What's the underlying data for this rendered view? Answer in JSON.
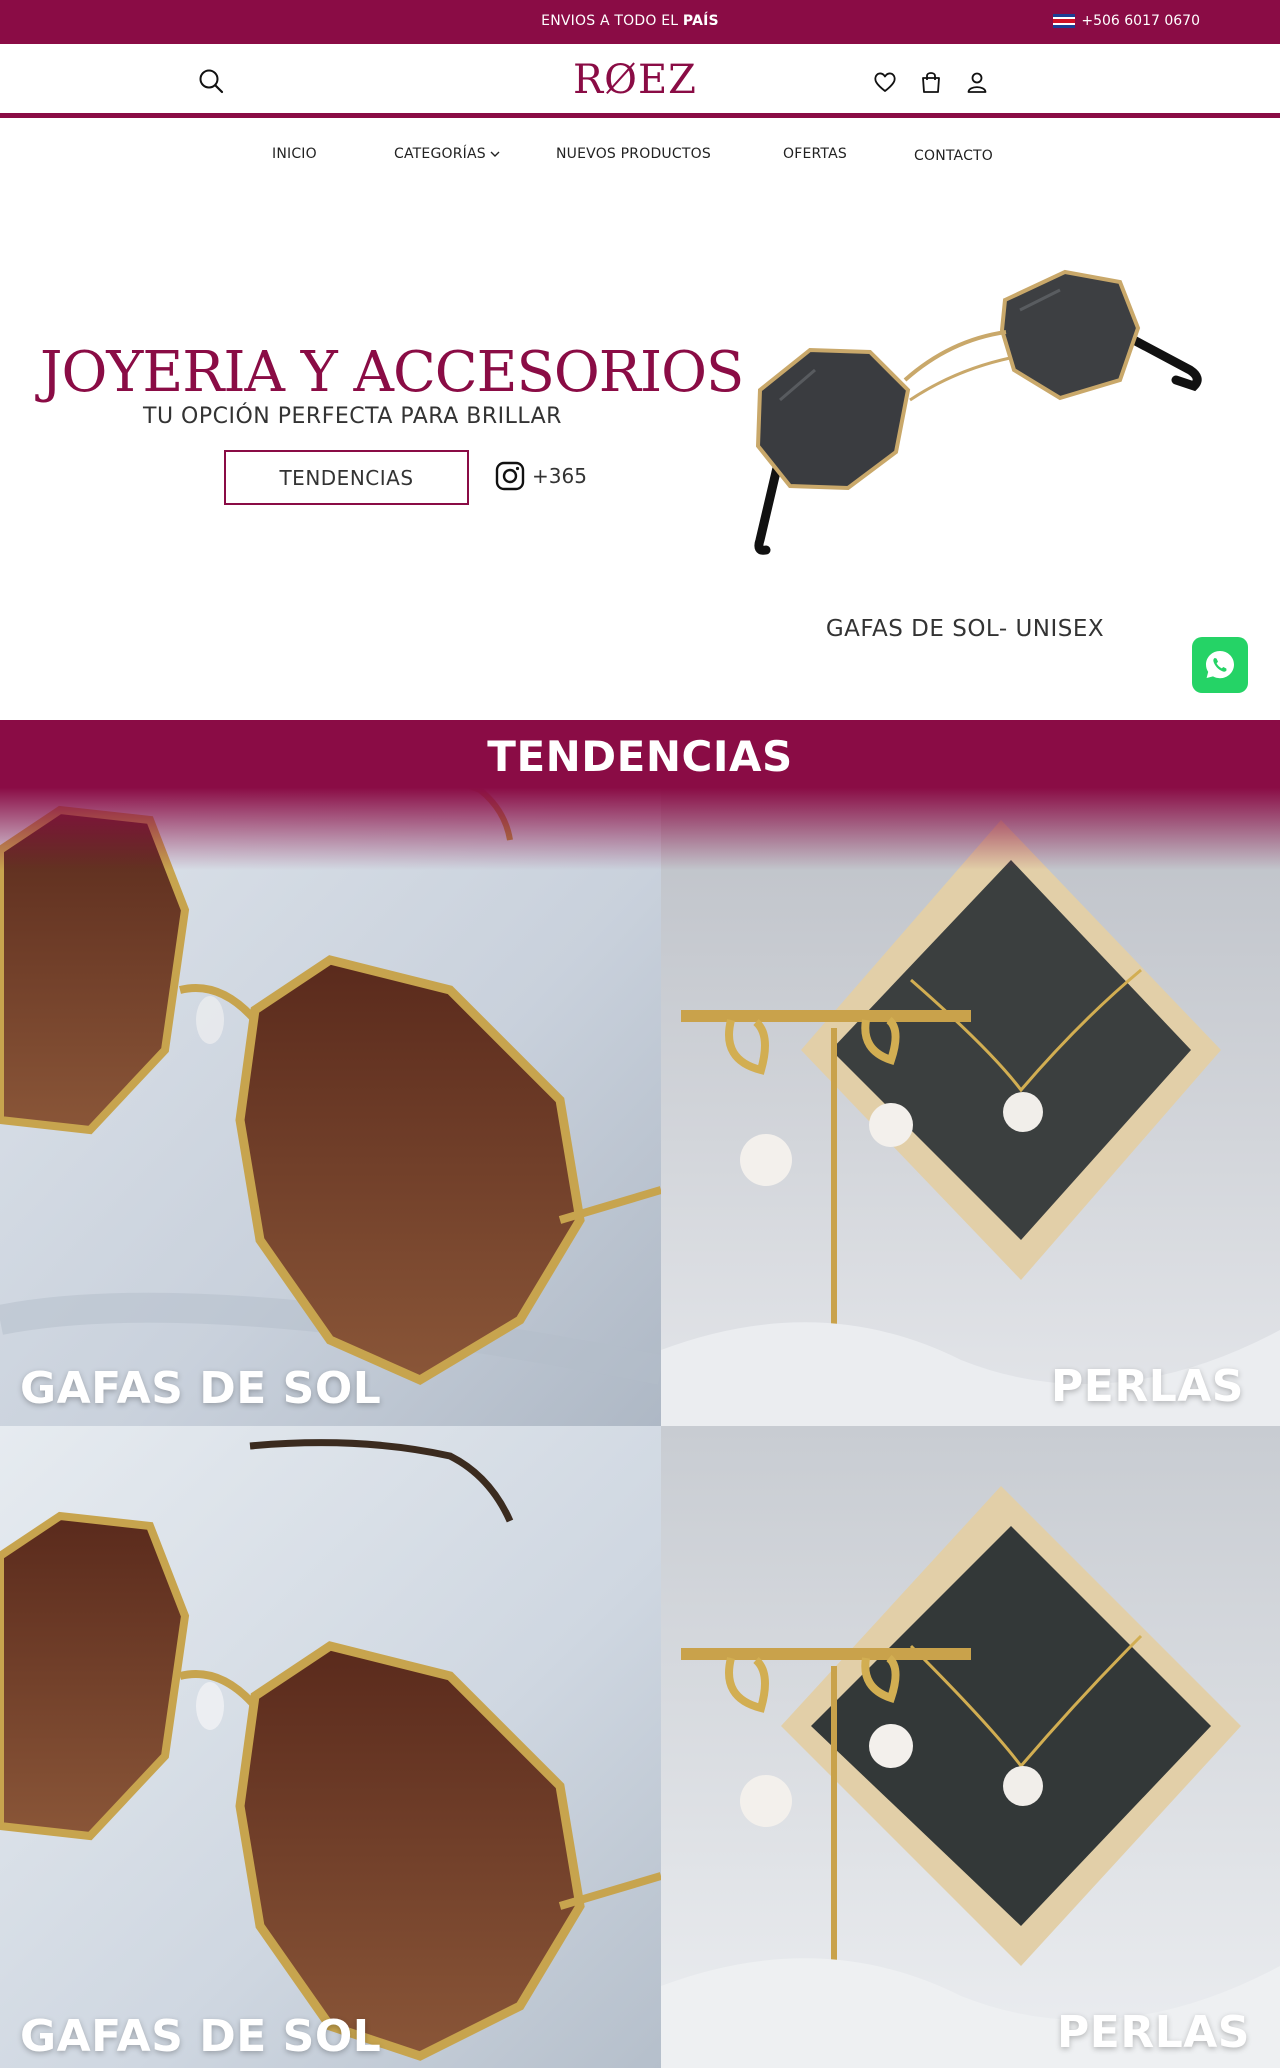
{
  "topbar": {
    "announce_prefix": "ENVIOS A TODO EL ",
    "announce_bold": "PAÍS",
    "phone": "+506 6017 0670",
    "background": "#8a0c45"
  },
  "header": {
    "logo_text": "RØEZ",
    "icons": [
      "search-icon",
      "heart-icon",
      "bag-icon",
      "user-icon"
    ]
  },
  "nav": {
    "items": [
      {
        "label": "INICIO"
      },
      {
        "label": "CATEGORÍAS"
      },
      {
        "label": "NUEVOS PRODUCTOS"
      },
      {
        "label": "OFERTAS"
      },
      {
        "label": "CONTACTO"
      }
    ]
  },
  "hero": {
    "title": "JOYERIA Y ACCESORIOS",
    "subtitle": "TU OPCIÓN PERFECTA PARA BRILLAR",
    "button_label": "TENDENCIAS",
    "instagram_count": "+365",
    "caption": "GAFAS DE SOL- UNISEX"
  },
  "trends": {
    "title": "TENDENCIAS",
    "tiles": [
      {
        "label": "GAFAS DE SOL"
      },
      {
        "label": "PERLAS"
      },
      {
        "label": "GAFAS DE SOL"
      },
      {
        "label": "PERLAS"
      }
    ]
  },
  "colors": {
    "brand": "#8a0c45",
    "whatsapp": "#25d366"
  }
}
